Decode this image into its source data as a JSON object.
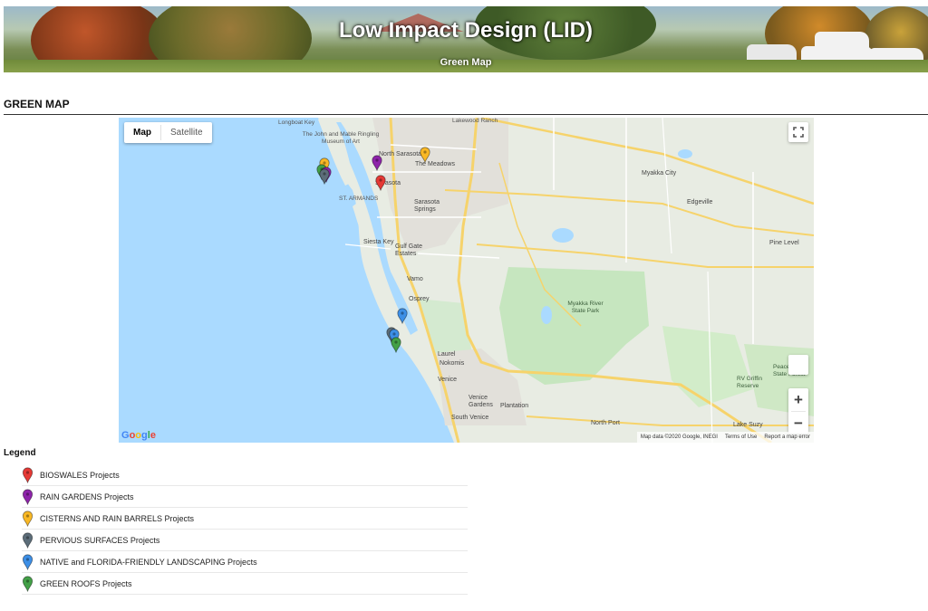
{
  "banner": {
    "title": "Low Impact Design (LID)",
    "subtitle": "Green Map"
  },
  "section": {
    "heading": "GREEN MAP"
  },
  "map": {
    "type_buttons": [
      {
        "label": "Map",
        "active": true
      },
      {
        "label": "Satellite",
        "active": false
      }
    ],
    "zoom_in": "+",
    "zoom_out": "−",
    "logo": "Google",
    "attribution": [
      "Map data ©2020 Google, INEGI",
      "Terms of Use",
      "Report a map error"
    ],
    "labels": {
      "longboat": "Longboat Key",
      "lakewood": "Lakewood Ranch",
      "ringling": "The John and Mable Ringling Museum of Art",
      "north_sarasota": "North Sarasota",
      "meadows": "The Meadows",
      "sarasota": "Sarasota",
      "st_armands": "ST. ARMANDS",
      "sarasota_springs": "Sarasota Springs",
      "siesta": "Siesta Key",
      "gulf_gate": "Gulf Gate Estates",
      "vamo": "Vamo",
      "osprey": "Osprey",
      "myakka_city": "Myakka City",
      "edgeville": "Edgeville",
      "pine_level": "Pine Level",
      "myakka_park": "Myakka River State Park",
      "laurel": "Laurel",
      "nokomis": "Nokomis",
      "venice": "Venice",
      "venice_gardens": "Venice Gardens",
      "plantation": "Plantation",
      "south_venice": "South Venice",
      "north_port": "North Port",
      "rv_griffin": "RV Griffin Reserve",
      "lake_suzy": "Lake Suzy",
      "peace_river": "Peace River State Forest"
    },
    "markers": [
      {
        "category": "cisterns",
        "lon": -82.545,
        "lat": 27.345
      },
      {
        "category": "green_roofs",
        "lon": -82.548,
        "lat": 27.335
      },
      {
        "category": "rain_gardens",
        "lon": -82.542,
        "lat": 27.331
      },
      {
        "category": "pervious",
        "lon": -82.545,
        "lat": 27.328
      },
      {
        "category": "rain_gardens",
        "lon": -82.475,
        "lat": 27.35
      },
      {
        "category": "cisterns",
        "lon": -82.41,
        "lat": 27.362
      },
      {
        "category": "bioswales",
        "lon": -82.47,
        "lat": 27.318
      },
      {
        "category": "native",
        "lon": -82.44,
        "lat": 27.105
      },
      {
        "category": "pervious",
        "lon": -82.455,
        "lat": 27.075
      },
      {
        "category": "native",
        "lon": -82.452,
        "lat": 27.072
      },
      {
        "category": "green_roofs",
        "lon": -82.449,
        "lat": 27.058
      }
    ]
  },
  "legend": {
    "title": "Legend",
    "items": [
      {
        "key": "bioswales",
        "label": "BIOSWALES Projects",
        "color": "#e53935"
      },
      {
        "key": "rain_gardens",
        "label": "RAIN GARDENS Projects",
        "color": "#8e24aa"
      },
      {
        "key": "cisterns",
        "label": "CISTERNS AND RAIN BARRELS Projects",
        "color": "#f9b825"
      },
      {
        "key": "pervious",
        "label": "PERVIOUS SURFACES Projects",
        "color": "#5c6d79"
      },
      {
        "key": "native",
        "label": "NATIVE and FLORIDA-FRIENDLY LANDSCAPING Projects",
        "color": "#3d8fe6"
      },
      {
        "key": "green_roofs",
        "label": "GREEN ROOFS Projects",
        "color": "#43a047"
      }
    ]
  }
}
